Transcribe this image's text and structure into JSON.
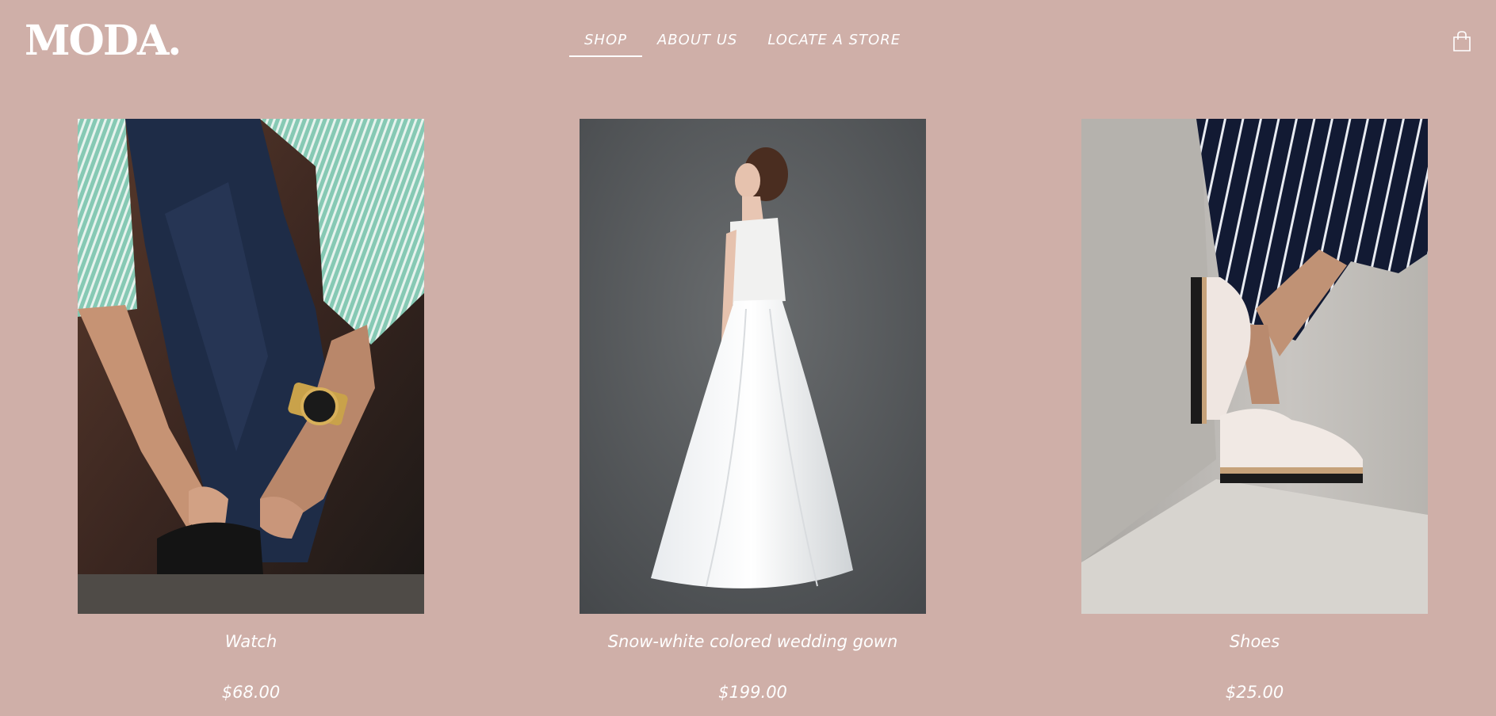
{
  "header": {
    "logo": "MODA.",
    "nav": [
      {
        "label": "SHOP",
        "active": true
      },
      {
        "label": "ABOUT US",
        "active": false
      },
      {
        "label": "LOCATE A STORE",
        "active": false
      }
    ],
    "cart_icon": "shopping-bag-icon"
  },
  "products": [
    {
      "name": "Watch",
      "price": "$68.00"
    },
    {
      "name": "Snow-white colored wedding gown",
      "price": "$199.00"
    },
    {
      "name": "Shoes",
      "price": "$25.00"
    }
  ],
  "colors": {
    "background": "#cfafa8",
    "text": "#ffffff"
  }
}
